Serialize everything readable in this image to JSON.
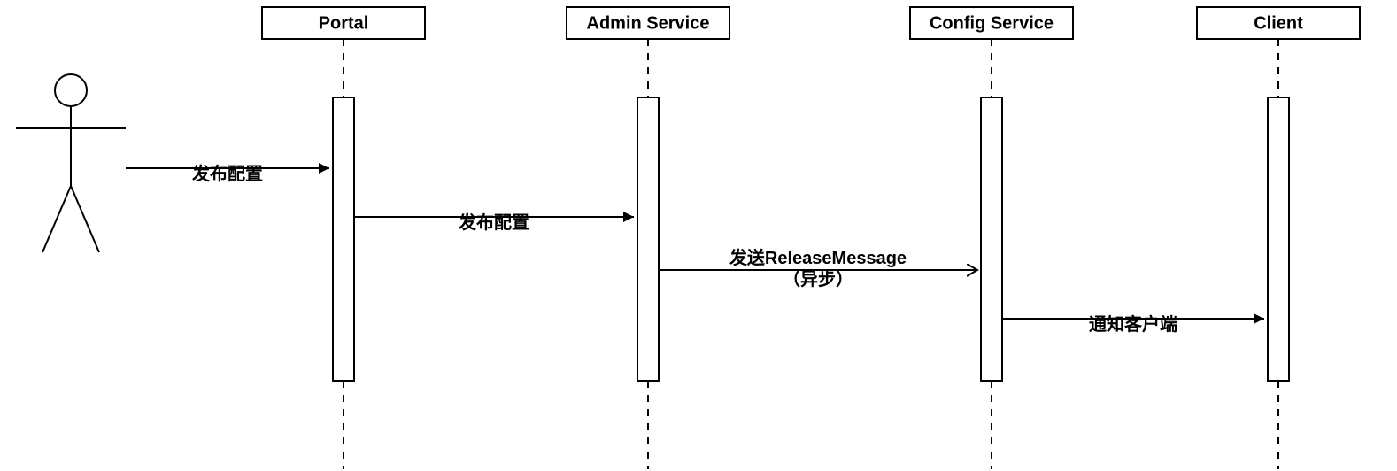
{
  "participants": {
    "portal": "Portal",
    "admin": "Admin Service",
    "config": "Config Service",
    "client": "Client"
  },
  "messages": {
    "m1": "发布配置",
    "m2": "发布配置",
    "m3a": "发送ReleaseMessage",
    "m3b": "（异步）",
    "m4": "通知客户端"
  }
}
